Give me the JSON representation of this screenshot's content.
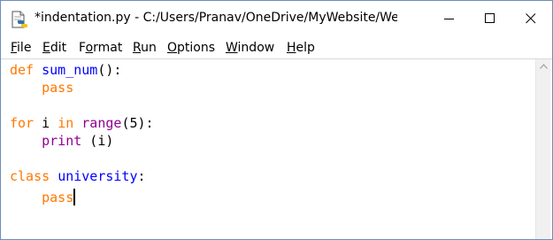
{
  "window": {
    "title": "*indentation.py - C:/Users/Pranav/OneDrive/MyWebsite/We..."
  },
  "controls": {
    "minimize_icon": "minimize-icon",
    "maximize_icon": "maximize-icon",
    "close_icon": "close-icon"
  },
  "menu": {
    "items": [
      {
        "accel": "F",
        "rest": "ile"
      },
      {
        "accel": "E",
        "rest": "dit"
      },
      {
        "pre": "F",
        "accel": "o",
        "rest": "rmat"
      },
      {
        "accel": "R",
        "rest": "un"
      },
      {
        "accel": "O",
        "rest": "ptions"
      },
      {
        "accel": "W",
        "rest": "indow"
      },
      {
        "accel": "H",
        "rest": "elp"
      }
    ]
  },
  "code": {
    "line1": {
      "kw": "def",
      "sp": " ",
      "name": "sum_num",
      "rest": "():"
    },
    "line2": {
      "indent": "    ",
      "kw": "pass"
    },
    "line4": {
      "kw": "for",
      "mid1": " i ",
      "kw2": "in",
      "sp": " ",
      "builtin": "range",
      "rest": "(5):"
    },
    "line5": {
      "indent": "    ",
      "builtin": "print",
      "rest": " (i)"
    },
    "line7": {
      "kw": "class",
      "sp": " ",
      "name": "university",
      "rest": ":"
    },
    "line8": {
      "indent": "    ",
      "kw": "pass"
    }
  },
  "colors": {
    "keyword": "#ff7700",
    "definition": "#0000ff",
    "builtin": "#900090"
  }
}
